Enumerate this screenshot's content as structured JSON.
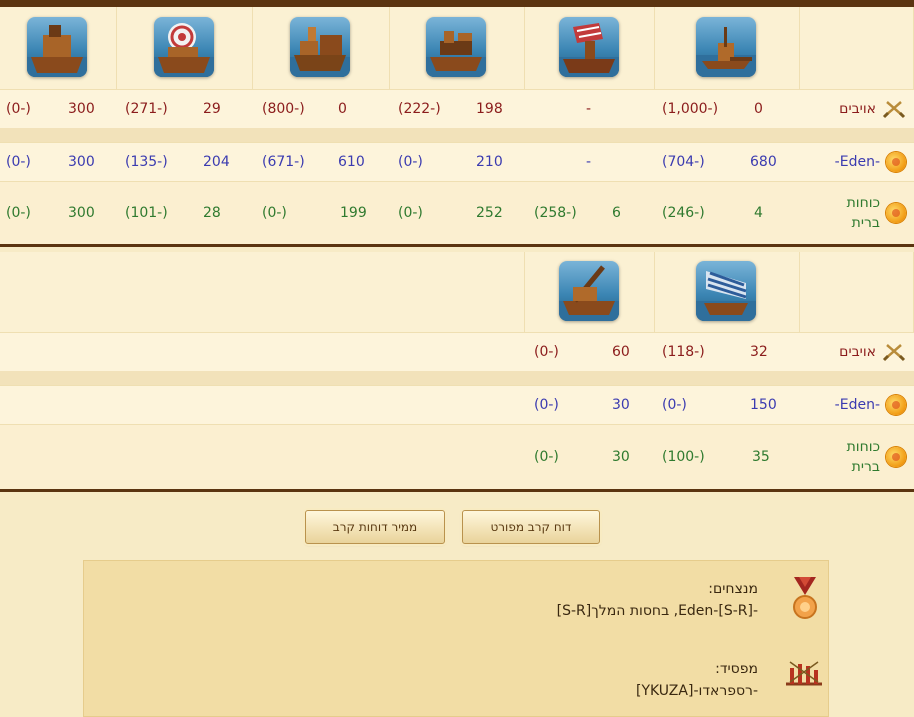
{
  "rows": {
    "enemies": "אויבים",
    "eden": "-Eden-",
    "allies": "כוחות ברית"
  },
  "table1": {
    "units": [
      "unit-icon-1",
      "unit-icon-2",
      "unit-icon-3",
      "unit-icon-4",
      "unit-icon-5",
      "unit-icon-6"
    ],
    "enemies": [
      [
        "0",
        "(1,000-)"
      ],
      [
        "-",
        ""
      ],
      [
        "198",
        "(222-)"
      ],
      [
        "0",
        "(800-)"
      ],
      [
        "29",
        "(271-)"
      ],
      [
        "300",
        "(0-)"
      ]
    ],
    "eden": [
      [
        "680",
        "(704-)"
      ],
      [
        "-",
        ""
      ],
      [
        "210",
        "(0-)"
      ],
      [
        "610",
        "(671-)"
      ],
      [
        "204",
        "(135-)"
      ],
      [
        "300",
        "(0-)"
      ]
    ],
    "allies": [
      [
        "4",
        "(246-)"
      ],
      [
        "6",
        "(258-)"
      ],
      [
        "252",
        "(0-)"
      ],
      [
        "199",
        "(0-)"
      ],
      [
        "28",
        "(101-)"
      ],
      [
        "300",
        "(0-)"
      ]
    ]
  },
  "table2": {
    "enemies": [
      [
        "32",
        "(118-)"
      ],
      [
        "60",
        "(0-)"
      ]
    ],
    "eden": [
      [
        "150",
        "(0-)"
      ],
      [
        "30",
        "(0-)"
      ]
    ],
    "allies": [
      [
        "35",
        "(100-)"
      ],
      [
        "30",
        "(0-)"
      ]
    ]
  },
  "buttons": {
    "detailed_report": "דוח קרב מפורט",
    "reports_archive": "ממיר דוחות קרב"
  },
  "summary": {
    "winners_label": "מנצחים:",
    "winners_value": "-[S-R]-Eden, בחסות המלך[S-R]",
    "loser_label": "מפסיד:",
    "loser_value": "-רספראדו-[YKUZA]"
  }
}
